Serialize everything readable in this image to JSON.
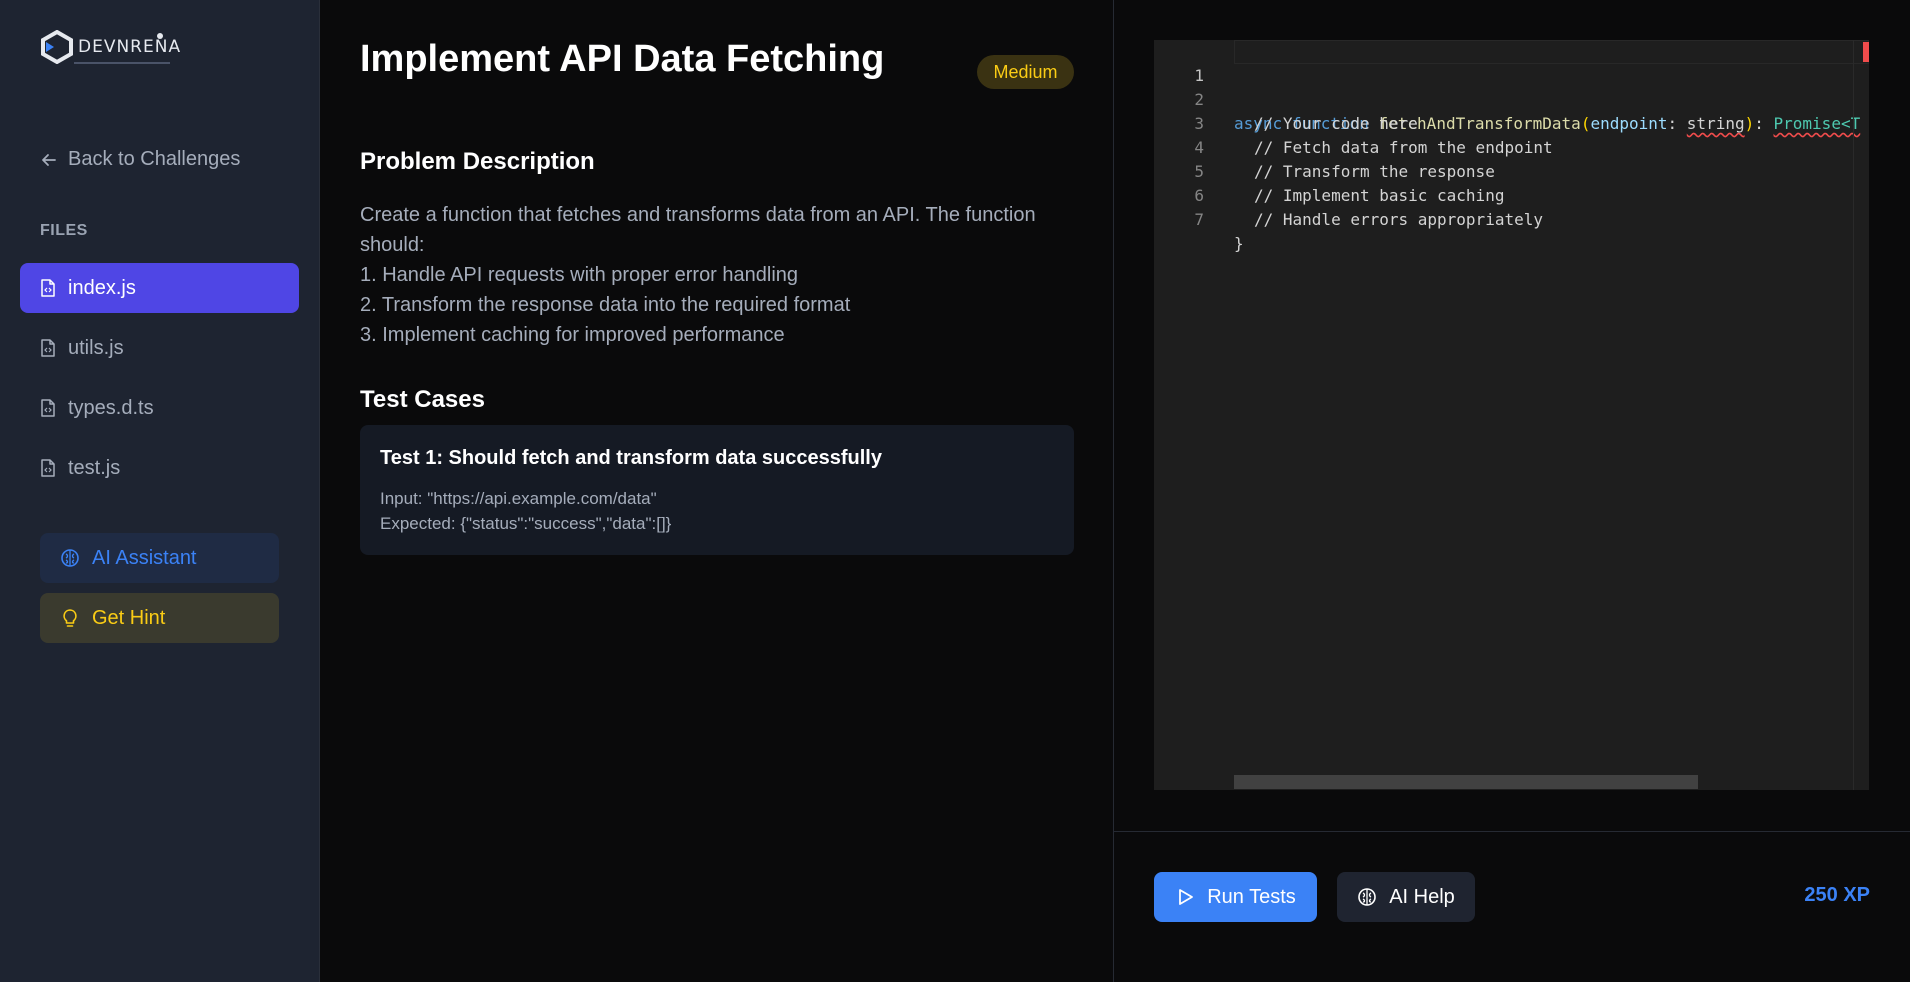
{
  "brand": {
    "name": "DEVNRENA"
  },
  "sidebar": {
    "back_label": "Back to Challenges",
    "files_label": "FILES",
    "files": [
      {
        "name": "index.js",
        "active": true
      },
      {
        "name": "utils.js",
        "active": false
      },
      {
        "name": "types.d.ts",
        "active": false
      },
      {
        "name": "test.js",
        "active": false
      }
    ],
    "ai_assistant_label": "AI Assistant",
    "hint_label": "Get Hint"
  },
  "problem": {
    "title": "Implement API Data Fetching",
    "difficulty": "Medium",
    "description_heading": "Problem Description",
    "description_lines": [
      "Create a function that fetches and transforms data from an API. The function should:",
      "1. Handle API requests with proper error handling",
      "2. Transform the response data into the required format",
      "3. Implement caching for improved performance"
    ],
    "tests_heading": "Test Cases",
    "tests": [
      {
        "title": "Test 1: Should fetch and transform data successfully",
        "input": "Input: \"https://api.example.com/data\"",
        "expected": "Expected: {\"status\":\"success\",\"data\":[]}"
      }
    ]
  },
  "editor": {
    "line_numbers": [
      "1",
      "2",
      "3",
      "4",
      "5",
      "6",
      "7"
    ],
    "line1": {
      "kw1": "async",
      "kw2": "function",
      "fn": "fetchAndTransformData",
      "open": "(",
      "param": "endpoint",
      "colon": ":",
      "type": "string",
      "close": ")",
      "colon2": ":",
      "ret": "Promise<T"
    },
    "comments": [
      "// Your code here",
      "// Fetch data from the endpoint",
      "// Transform the response",
      "// Implement basic caching",
      "// Handle errors appropriately"
    ],
    "closing_brace": "}"
  },
  "footer": {
    "run_label": "Run Tests",
    "help_label": "AI Help",
    "xp": "250 XP"
  },
  "colors": {
    "accent": "#4f46e5",
    "primary": "#3b82f6",
    "warning": "#facc15"
  }
}
